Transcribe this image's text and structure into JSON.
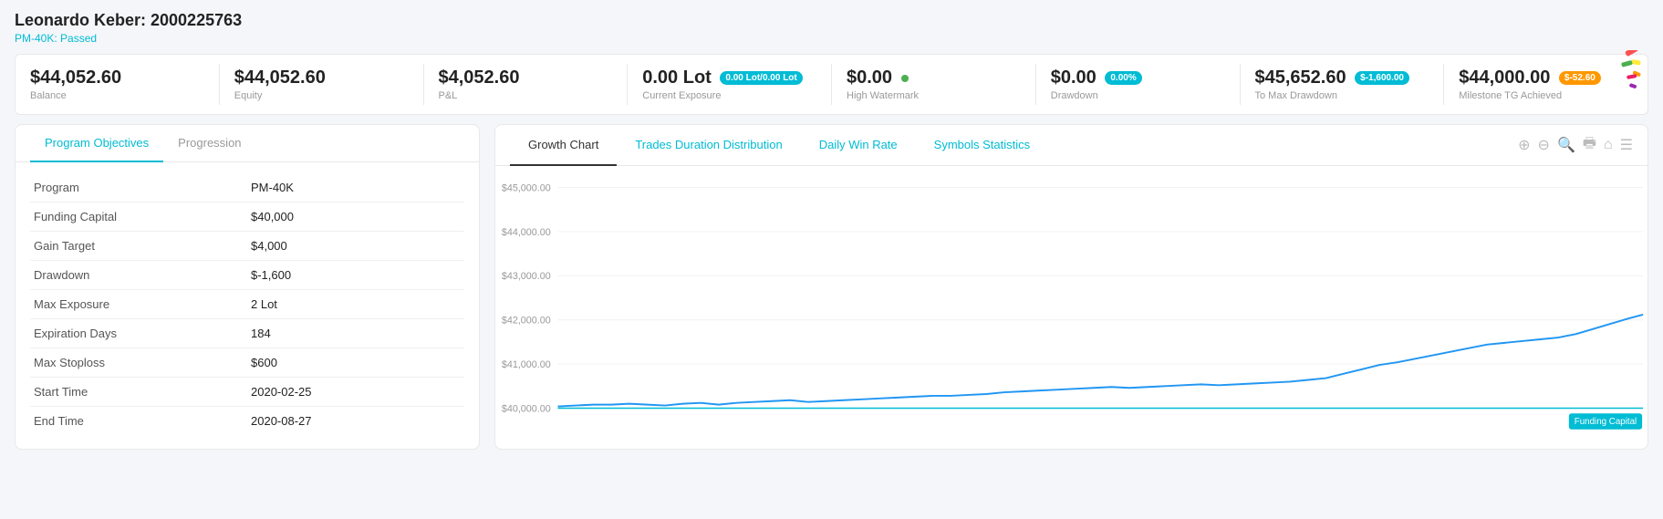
{
  "account": {
    "name": "Leonardo Keber: 2000225763",
    "status": "PM-40K: Passed"
  },
  "stats": [
    {
      "id": "balance",
      "value": "$44,052.60",
      "label": "Balance",
      "badge": null
    },
    {
      "id": "equity",
      "value": "$44,052.60",
      "label": "Equity",
      "badge": null
    },
    {
      "id": "pnl",
      "value": "$4,052.60",
      "label": "P&L",
      "badge": null
    },
    {
      "id": "exposure",
      "value": "0.00 Lot",
      "label": "Current Exposure",
      "badge": "0.00 Lot/0.00 Lot",
      "badge_type": "teal"
    },
    {
      "id": "watermark",
      "value": "$0.00",
      "label": "High Watermark",
      "badge_dot": true
    },
    {
      "id": "drawdown",
      "value": "$0.00",
      "label": "Drawdown",
      "badge": "0.00%",
      "badge_type": "teal"
    },
    {
      "id": "max_drawdown",
      "value": "$45,652.60",
      "label": "To Max Drawdown",
      "badge": "$-1,600.00",
      "badge_type": "teal"
    },
    {
      "id": "milestone",
      "value": "$44,000.00",
      "label": "Milestone TG Achieved",
      "badge": "$-52.60",
      "badge_type": "orange",
      "has_stickers": true
    }
  ],
  "left_panel": {
    "tabs": [
      {
        "id": "objectives",
        "label": "Program Objectives",
        "active": true
      },
      {
        "id": "progression",
        "label": "Progression",
        "active": false
      }
    ],
    "table_rows": [
      {
        "key": "Program",
        "value": "PM-40K"
      },
      {
        "key": "Funding Capital",
        "value": "$40,000"
      },
      {
        "key": "Gain Target",
        "value": "$4,000"
      },
      {
        "key": "Drawdown",
        "value": "$-1,600"
      },
      {
        "key": "Max Exposure",
        "value": "2 Lot"
      },
      {
        "key": "Expiration Days",
        "value": "184"
      },
      {
        "key": "Max Stoploss",
        "value": "$600"
      },
      {
        "key": "Start Time",
        "value": "2020-02-25"
      },
      {
        "key": "End Time",
        "value": "2020-08-27"
      }
    ]
  },
  "right_panel": {
    "tabs": [
      {
        "id": "growth",
        "label": "Growth Chart",
        "active": true
      },
      {
        "id": "duration",
        "label": "Trades Duration Distribution",
        "active": false
      },
      {
        "id": "winrate",
        "label": "Daily Win Rate",
        "active": false
      },
      {
        "id": "symbols",
        "label": "Symbols Statistics",
        "active": false
      }
    ],
    "toolbar_icons": [
      "zoom-in",
      "zoom-out",
      "magnify",
      "print",
      "home",
      "menu"
    ],
    "chart": {
      "y_labels": [
        "$45,000.00",
        "$44,000.00",
        "$43,000.00",
        "$42,000.00",
        "$41,000.00",
        "$40,000.00"
      ],
      "funding_capital_label": "Funding Capital"
    }
  }
}
